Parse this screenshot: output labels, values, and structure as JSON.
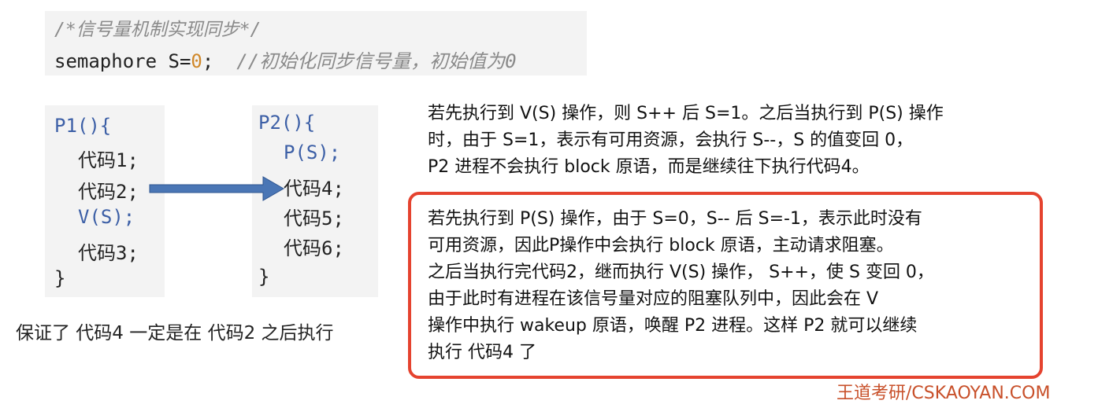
{
  "top_code": {
    "comment": "/*信号量机制实现同步*/",
    "decl": "semaphore S=",
    "init_value": "0",
    "semicolon": ";",
    "init_comment": "//初始化同步信号量，初始值为0"
  },
  "p1": {
    "header": "P1(){",
    "lines": [
      "代码1;",
      "代码2;",
      "V(S);",
      "代码3;"
    ],
    "close": "}"
  },
  "p2": {
    "header": "P2(){",
    "lines": [
      "P(S);",
      "代码4;",
      "代码5;",
      "代码6;"
    ],
    "close": "}"
  },
  "note": "保证了 代码4 一定是在 代码2 之后执行",
  "desc1": [
    "若先执行到 V(S) 操作，则 S++ 后 S=1。之后当执行到 P(S) 操作",
    "时，由于 S=1，表示有可用资源，会执行 S--，S 的值变回 0，",
    "P2 进程不会执行 block 原语，而是继续往下执行代码4。"
  ],
  "desc2": [
    "若先执行到 P(S) 操作，由于 S=0，S-- 后 S=-1，表示此时没有",
    "可用资源，因此P操作中会执行 block 原语，主动请求阻塞。",
    "之后当执行完代码2，继而执行 V(S) 操作， S++，使 S 变回 0，",
    "由于此时有进程在该信号量对应的阻塞队列中，因此会在 V",
    "操作中执行 wakeup 原语，唤醒 P2 进程。这样 P2 就可以继续",
    "执行 代码4 了"
  ],
  "watermark": "王道考研/CSKAOYAN.COM",
  "colors": {
    "keyword": "#3c5fa6",
    "number": "#d0882a",
    "comment": "#8a8a8a",
    "arrow": "#4a76b5",
    "highlight_box": "#e5432f"
  }
}
